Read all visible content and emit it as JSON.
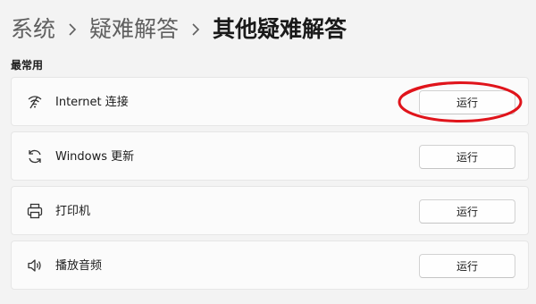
{
  "breadcrumb": {
    "items": [
      "系统",
      "疑难解答",
      "其他疑难解答"
    ]
  },
  "section_label": "最常用",
  "items": [
    {
      "label": "Internet 连接",
      "icon": "wifi-icon",
      "button": "运行"
    },
    {
      "label": "Windows 更新",
      "icon": "refresh-icon",
      "button": "运行"
    },
    {
      "label": "打印机",
      "icon": "printer-icon",
      "button": "运行"
    },
    {
      "label": "播放音频",
      "icon": "speaker-icon",
      "button": "运行"
    }
  ],
  "colors": {
    "background": "#f3f3f3",
    "card": "#fbfbfb",
    "annotation": "#e0141b"
  }
}
